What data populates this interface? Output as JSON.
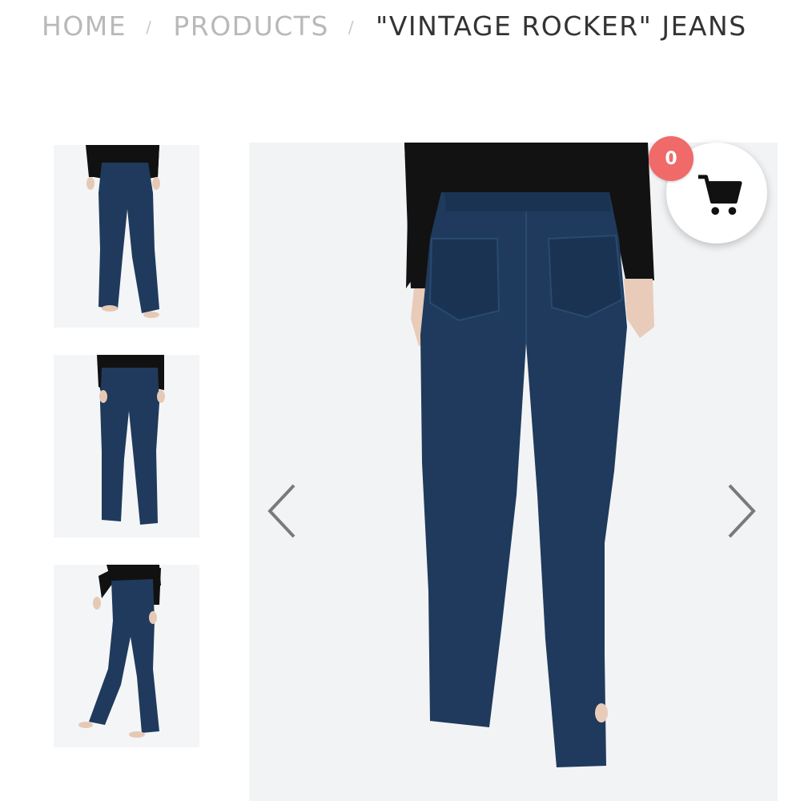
{
  "breadcrumb": {
    "home": "HOME",
    "separator": "/",
    "products": "PRODUCTS",
    "current": "\"VINTAGE ROCKER\" JEANS"
  },
  "gallery": {
    "thumbnails": [
      {
        "view": "front"
      },
      {
        "view": "back"
      },
      {
        "view": "side"
      }
    ],
    "main_view": "back",
    "prev_icon": "chevron-left-icon",
    "next_icon": "chevron-right-icon"
  },
  "cart": {
    "count": "0",
    "icon": "shopping-cart-icon",
    "badge_color": "#f06a6a"
  },
  "colors": {
    "denim": "#1f3a5c",
    "top": "#111111",
    "background": "#f2f3f5"
  }
}
